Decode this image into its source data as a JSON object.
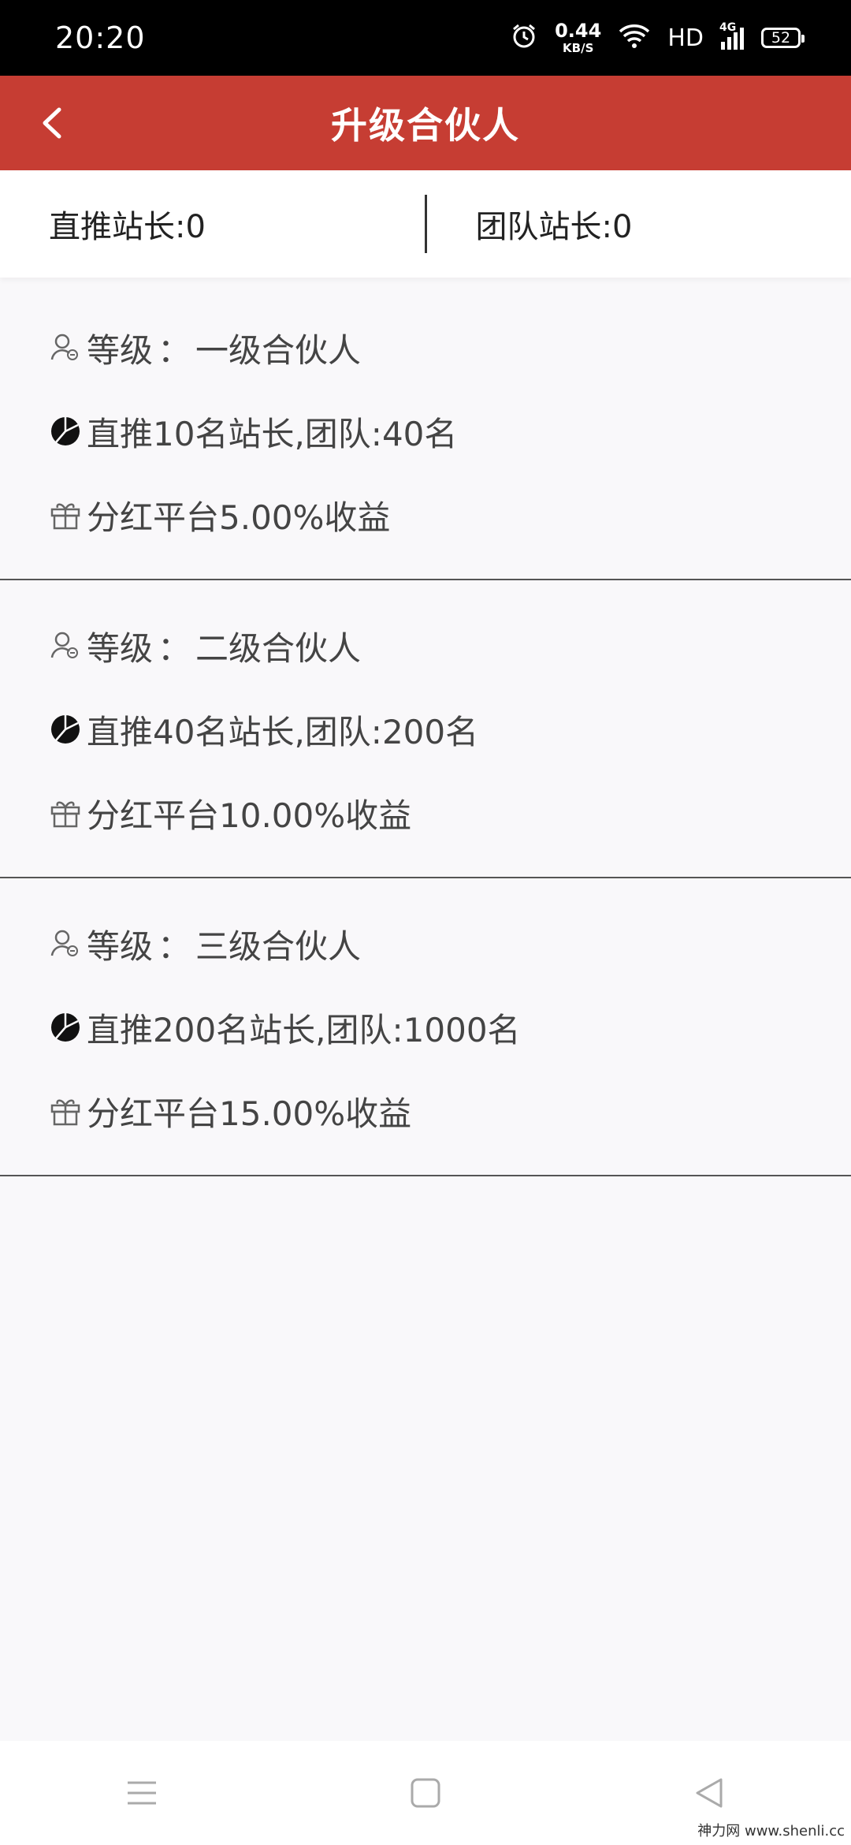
{
  "status": {
    "time": "20:20",
    "net_speed_value": "0.44",
    "net_speed_unit": "KB/S",
    "hd": "HD",
    "signal": "4G",
    "battery": "52"
  },
  "header": {
    "title": "升级合伙人",
    "color": "#c63d33"
  },
  "stats": {
    "direct": "直推站长:0",
    "team": "团队站长:0"
  },
  "levels": [
    {
      "level_label": "等级",
      "level_value": "一级合伙人",
      "requirement": "直推10名站长,团队:40名",
      "benefit": "分红平台5.00%收益"
    },
    {
      "level_label": "等级",
      "level_value": "二级合伙人",
      "requirement": "直推40名站长,团队:200名",
      "benefit": "分红平台10.00%收益"
    },
    {
      "level_label": "等级",
      "level_value": "三级合伙人",
      "requirement": "直推200名站长,团队:1000名",
      "benefit": "分红平台15.00%收益"
    }
  ],
  "level_colon": "：",
  "watermark": "神力网 www.shenli.cc"
}
